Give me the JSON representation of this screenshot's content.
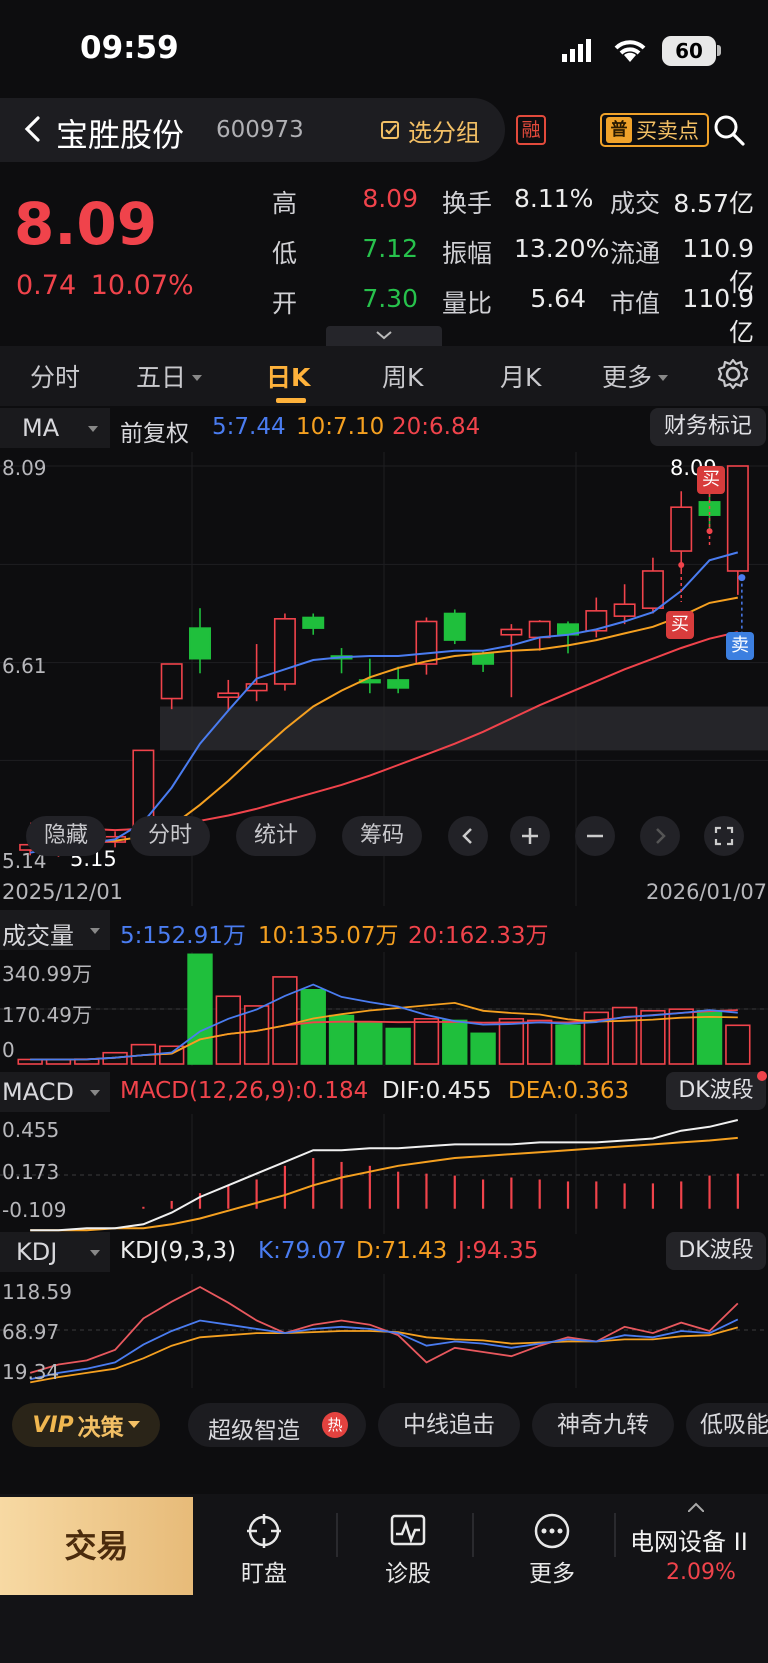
{
  "status_bar": {
    "time": "09:59",
    "battery": "60"
  },
  "header": {
    "stock_name": "宝胜股份",
    "stock_code": "600973",
    "group_button": "选分组",
    "rong_badge": "融",
    "buysell_icon": "普",
    "buysell_label": "买卖点"
  },
  "quote": {
    "price": "8.09",
    "change": "0.74",
    "change_pct": "10.07%",
    "stats": [
      {
        "label": "高",
        "value": "8.09",
        "color": "red"
      },
      {
        "label": "换手",
        "value": "8.11%",
        "color": "white"
      },
      {
        "label": "成交",
        "value": "8.57亿",
        "color": "white"
      },
      {
        "label": "低",
        "value": "7.12",
        "color": "green"
      },
      {
        "label": "振幅",
        "value": "13.20%",
        "color": "white"
      },
      {
        "label": "流通",
        "value": "110.9亿",
        "color": "white"
      },
      {
        "label": "开",
        "value": "7.30",
        "color": "green"
      },
      {
        "label": "量比",
        "value": "5.64",
        "color": "white"
      },
      {
        "label": "市值",
        "value": "110.9亿",
        "color": "white"
      }
    ]
  },
  "tabs": [
    {
      "label": "分时",
      "has_arrow": false
    },
    {
      "label": "五日",
      "has_arrow": true
    },
    {
      "label": "日K",
      "has_arrow": false,
      "active": true
    },
    {
      "label": "周K",
      "has_arrow": false
    },
    {
      "label": "月K",
      "has_arrow": false
    },
    {
      "label": "更多",
      "has_arrow": true
    }
  ],
  "ma_legend": {
    "indicator": "MA",
    "adjust": "前复权",
    "ma5": "5:7.44",
    "ma10": "10:7.10",
    "ma20": "20:6.84",
    "finance_button": "财务标记"
  },
  "price_axis": {
    "top": "8.09",
    "mid": "6.61",
    "low": "5.14",
    "low_marker": "5.15",
    "high_marker": "8.09"
  },
  "date_axis": {
    "start": "2025/12/01",
    "end": "2026/01/07"
  },
  "chart_tools": {
    "hide": "隐藏",
    "timeshare": "分时",
    "stats": "统计",
    "chips": "筹码"
  },
  "signals": {
    "buy": "买",
    "sell": "卖"
  },
  "volume_legend": {
    "title": "成交量",
    "ma5": "5:152.91万",
    "ma10": "10:135.07万",
    "ma20": "20:162.33万",
    "axis_top": "340.99万",
    "axis_mid": "170.49万",
    "axis_zero": "0"
  },
  "macd_legend": {
    "title": "MACD",
    "macd": "MACD(12,26,9):0.184",
    "dif": "DIF:0.455",
    "dea": "DEA:0.363",
    "button": "DK波段",
    "axis_top": "0.455",
    "axis_mid": "0.173",
    "axis_low": "-0.109"
  },
  "kdj_legend": {
    "title": "KDJ",
    "params": "KDJ(9,3,3)",
    "k": "K:79.07",
    "d": "D:71.43",
    "j": "J:94.35",
    "button": "DK波段",
    "axis_top": "118.59",
    "axis_mid": "68.97",
    "axis_low": "19.34"
  },
  "strategy_bar": {
    "vip": "VIP",
    "vip_label": "决策",
    "items": [
      "超级智造",
      "中线追击",
      "神奇九转",
      "低吸能"
    ],
    "hot_badge": "热"
  },
  "bottom_nav": {
    "trade": "交易",
    "items": [
      "盯盘",
      "诊股",
      "更多"
    ],
    "sector_name": "电网设备 II",
    "sector_change": "2.09%"
  },
  "chart_data": {
    "type": "candlestick",
    "x_start": "2025/12/01",
    "x_end": "2026/01/07",
    "ylim": [
      5.14,
      8.09
    ],
    "candles": [
      {
        "o": 5.2,
        "c": 5.24,
        "h": 5.26,
        "l": 5.16
      },
      {
        "o": 5.22,
        "c": 5.26,
        "h": 5.28,
        "l": 5.15
      },
      {
        "o": 5.24,
        "c": 5.28,
        "h": 5.3,
        "l": 5.2
      },
      {
        "o": 5.26,
        "c": 5.3,
        "h": 5.34,
        "l": 5.22
      },
      {
        "o": 5.3,
        "c": 5.95,
        "h": 5.95,
        "l": 5.28
      },
      {
        "o": 6.34,
        "c": 6.6,
        "h": 6.6,
        "l": 6.26
      },
      {
        "o": 6.87,
        "c": 6.64,
        "h": 7.02,
        "l": 6.53
      },
      {
        "o": 6.35,
        "c": 6.38,
        "h": 6.48,
        "l": 6.25
      },
      {
        "o": 6.4,
        "c": 6.45,
        "h": 6.75,
        "l": 6.32
      },
      {
        "o": 6.45,
        "c": 6.94,
        "h": 6.98,
        "l": 6.4
      },
      {
        "o": 6.95,
        "c": 6.87,
        "h": 6.98,
        "l": 6.82
      },
      {
        "o": 6.66,
        "c": 6.64,
        "h": 6.72,
        "l": 6.53
      },
      {
        "o": 6.48,
        "c": 6.46,
        "h": 6.64,
        "l": 6.38
      },
      {
        "o": 6.48,
        "c": 6.42,
        "h": 6.58,
        "l": 6.38
      },
      {
        "o": 6.6,
        "c": 6.92,
        "h": 6.95,
        "l": 6.52
      },
      {
        "o": 6.98,
        "c": 6.78,
        "h": 7.01,
        "l": 6.75
      },
      {
        "o": 6.68,
        "c": 6.6,
        "h": 6.7,
        "l": 6.54
      },
      {
        "o": 6.82,
        "c": 6.86,
        "h": 6.9,
        "l": 6.35
      },
      {
        "o": 6.8,
        "c": 6.92,
        "h": 6.93,
        "l": 6.7
      },
      {
        "o": 6.9,
        "c": 6.82,
        "h": 6.92,
        "l": 6.68
      },
      {
        "o": 6.85,
        "c": 7.0,
        "h": 7.1,
        "l": 6.8
      },
      {
        "o": 6.96,
        "c": 7.05,
        "h": 7.2,
        "l": 6.9
      },
      {
        "o": 7.02,
        "c": 7.3,
        "h": 7.4,
        "l": 6.98
      },
      {
        "o": 7.45,
        "c": 7.78,
        "h": 7.9,
        "l": 7.3
      },
      {
        "o": 7.82,
        "c": 7.72,
        "h": 7.9,
        "l": 7.6
      },
      {
        "o": 7.3,
        "c": 8.09,
        "h": 8.09,
        "l": 7.12
      }
    ],
    "ma5": [
      5.18,
      5.22,
      5.25,
      5.28,
      5.41,
      5.67,
      6.0,
      6.25,
      6.49,
      6.56,
      6.63,
      6.65,
      6.66,
      6.66,
      6.68,
      6.7,
      6.7,
      6.74,
      6.8,
      6.82,
      6.86,
      6.92,
      6.99,
      7.15,
      7.38,
      7.44
    ],
    "ma10": [
      5.3,
      5.28,
      5.27,
      5.27,
      5.3,
      5.38,
      5.54,
      5.72,
      5.92,
      6.11,
      6.28,
      6.4,
      6.5,
      6.57,
      6.62,
      6.66,
      6.68,
      6.7,
      6.71,
      6.74,
      6.78,
      6.83,
      6.88,
      6.96,
      7.06,
      7.1
    ],
    "ma20": [
      5.4,
      5.38,
      5.36,
      5.35,
      5.36,
      5.38,
      5.42,
      5.46,
      5.51,
      5.57,
      5.63,
      5.69,
      5.76,
      5.84,
      5.92,
      6.0,
      6.09,
      6.19,
      6.29,
      6.38,
      6.47,
      6.56,
      6.64,
      6.72,
      6.79,
      6.84
    ],
    "volume": [
      14,
      14,
      15,
      35,
      60,
      55,
      340,
      210,
      180,
      270,
      230,
      150,
      130,
      110,
      140,
      135,
      95,
      140,
      135,
      120,
      160,
      175,
      165,
      170,
      165,
      120
    ],
    "volume_ylim": [
      0,
      340.99
    ],
    "macd_hist": [
      0,
      0,
      0,
      0,
      0.01,
      0.04,
      0.08,
      0.12,
      0.15,
      0.22,
      0.26,
      0.24,
      0.22,
      0.19,
      0.18,
      0.17,
      0.15,
      0.16,
      0.15,
      0.14,
      0.14,
      0.13,
      0.13,
      0.14,
      0.17,
      0.18
    ],
    "dif": [
      -0.11,
      -0.11,
      -0.1,
      -0.1,
      -0.08,
      -0.02,
      0.06,
      0.12,
      0.18,
      0.24,
      0.3,
      0.3,
      0.31,
      0.31,
      0.32,
      0.33,
      0.33,
      0.33,
      0.34,
      0.34,
      0.34,
      0.35,
      0.36,
      0.4,
      0.42,
      0.455
    ],
    "dea": [
      -0.11,
      -0.11,
      -0.11,
      -0.1,
      -0.1,
      -0.08,
      -0.05,
      -0.01,
      0.03,
      0.07,
      0.12,
      0.16,
      0.19,
      0.22,
      0.24,
      0.26,
      0.27,
      0.28,
      0.29,
      0.3,
      0.31,
      0.32,
      0.33,
      0.34,
      0.35,
      0.363
    ],
    "macd_ylim": [
      -0.109,
      0.455
    ],
    "k": [
      22,
      28,
      32,
      38,
      55,
      68,
      78,
      74,
      70,
      66,
      70,
      72,
      70,
      66,
      54,
      58,
      56,
      52,
      56,
      60,
      58,
      64,
      62,
      68,
      66,
      79.07
    ],
    "d": [
      19,
      24,
      28,
      32,
      42,
      54,
      62,
      64,
      66,
      66,
      67,
      68,
      68,
      67,
      62,
      60,
      59,
      56,
      57,
      58,
      58,
      60,
      60,
      63,
      64,
      71.43
    ],
    "j": [
      28,
      36,
      40,
      50,
      80,
      96,
      110,
      95,
      78,
      66,
      74,
      78,
      74,
      64,
      38,
      52,
      48,
      44,
      54,
      62,
      58,
      72,
      66,
      76,
      68,
      94.35
    ],
    "kdj_ylim": [
      19.34,
      118.59
    ]
  }
}
